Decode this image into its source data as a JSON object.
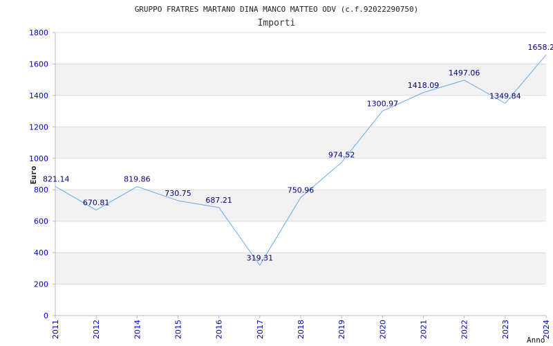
{
  "chart_data": {
    "type": "line",
    "title": "GRUPPO FRATRES MARTANO DINA MANCO MATTEO ODV (c.f.92022290750)",
    "subtitle": "Importi",
    "xlabel": "Anno",
    "ylabel": "Euro",
    "categories": [
      "2011",
      "2012",
      "2014",
      "2015",
      "2016",
      "2017",
      "2018",
      "2019",
      "2020",
      "2021",
      "2022",
      "2023",
      "2024"
    ],
    "values": [
      821.14,
      670.81,
      819.86,
      730.75,
      687.21,
      319.31,
      750.96,
      974.52,
      1300.97,
      1418.09,
      1497.06,
      1349.84,
      1658.2
    ],
    "value_labels": [
      "821.14",
      "670.81",
      "819.86",
      "730.75",
      "687.21",
      "319.31",
      "750.96",
      "974.52",
      "1300.97",
      "1418.09",
      "1497.06",
      "1349.84",
      "1658.2"
    ],
    "y_ticks": [
      "0",
      "200",
      "400",
      "600",
      "800",
      "1000",
      "1200",
      "1400",
      "1600",
      "1800"
    ],
    "ylim": [
      0,
      1800
    ],
    "grid": true,
    "colors": {
      "line": "#6aaaf0",
      "band": "#f2f2f2",
      "tick_label": "#0000cc",
      "value_label": "#000080",
      "text": "#222222"
    }
  }
}
